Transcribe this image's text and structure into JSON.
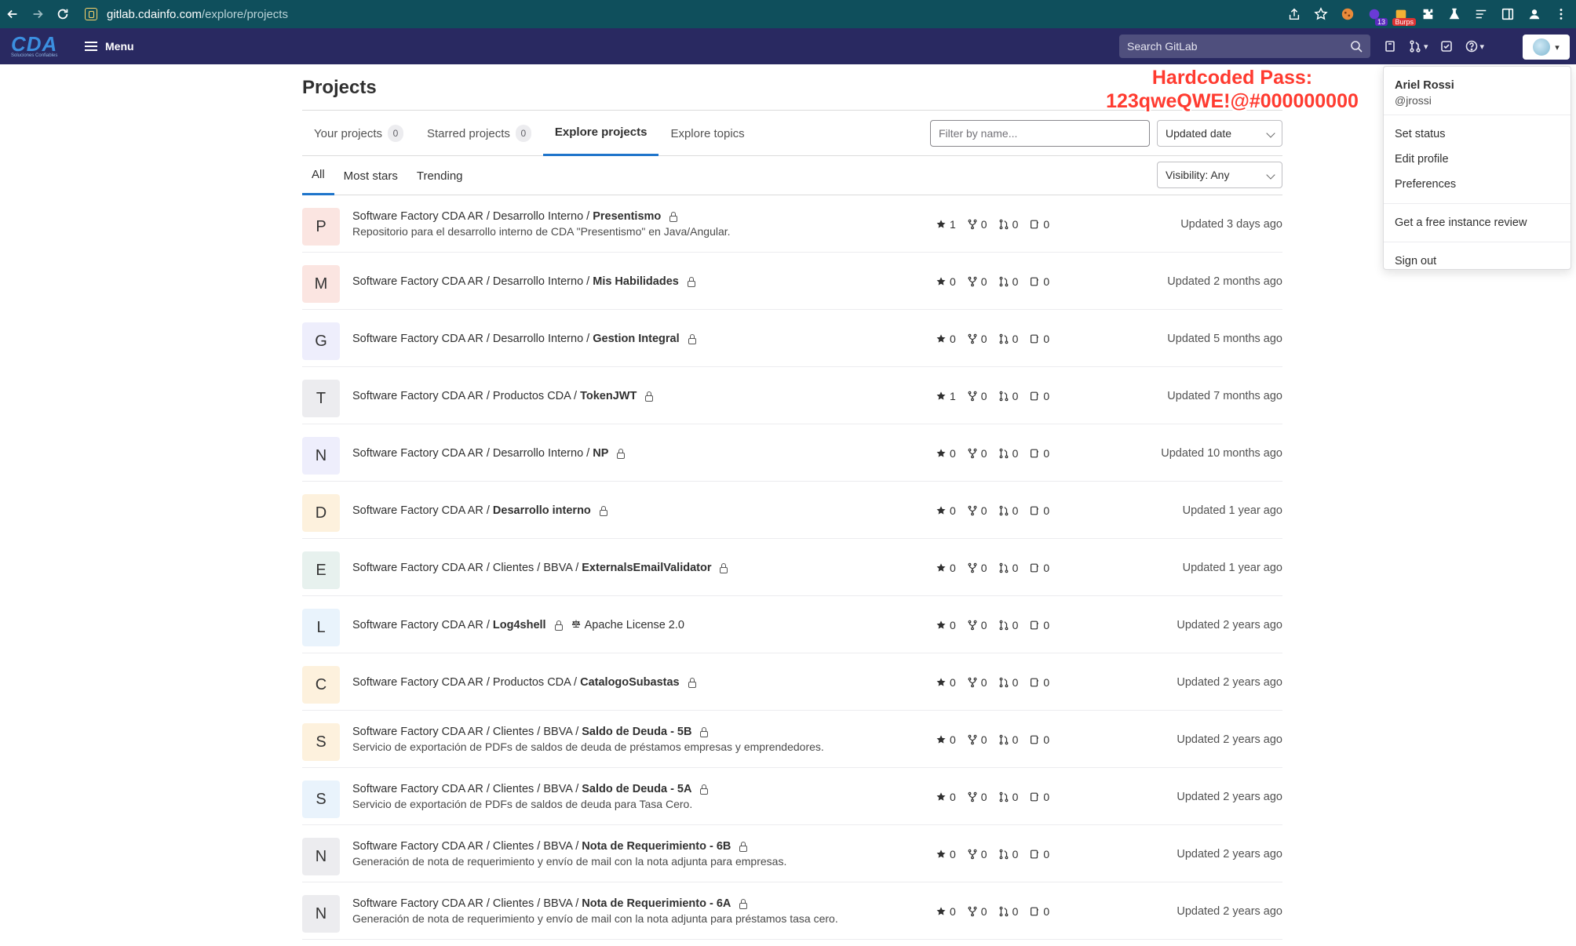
{
  "browser": {
    "url_domain": "gitlab.cdainfo.com",
    "url_path": "/explore/projects",
    "ext_badge_count": "13",
    "ext_badge_burp": "Burps"
  },
  "header": {
    "logo_text": "CDA",
    "logo_sub": "Soluciones Confiables",
    "menu_label": "Menu",
    "search_placeholder": "Search GitLab"
  },
  "page": {
    "title": "Projects",
    "tabs": [
      {
        "label": "Your projects",
        "count": "0"
      },
      {
        "label": "Starred projects",
        "count": "0"
      },
      {
        "label": "Explore projects"
      },
      {
        "label": "Explore topics"
      }
    ],
    "filter_placeholder": "Filter by name...",
    "sort_label": "Updated date",
    "subtabs": [
      "All",
      "Most stars",
      "Trending"
    ],
    "visibility_label": "Visibility: Any"
  },
  "annotation": {
    "line1": "Hardcoded Pass:",
    "line2": "123qweQWE!@#000000000"
  },
  "user_menu": {
    "name": "Ariel Rossi",
    "handle": "@jrossi",
    "items": [
      "Set status",
      "Edit profile",
      "Preferences"
    ],
    "review": "Get a free instance review",
    "signout": "Sign out"
  },
  "projects": [
    {
      "letter": "P",
      "bg": "#fbe5e1",
      "path": "Software Factory CDA AR / Desarrollo Interno / ",
      "name": "Presentismo",
      "desc": "Repositorio para el desarrollo interno de CDA \"Presentismo\" en Java/Angular.",
      "stars": "1",
      "forks": "0",
      "mrs": "0",
      "issues": "0",
      "updated": "Updated 3 days ago"
    },
    {
      "letter": "M",
      "bg": "#fbe5e1",
      "path": "Software Factory CDA AR / Desarrollo Interno / ",
      "name": "Mis Habilidades",
      "desc": "",
      "stars": "0",
      "forks": "0",
      "mrs": "0",
      "issues": "0",
      "updated": "Updated 2 months ago"
    },
    {
      "letter": "G",
      "bg": "#eeeefc",
      "path": "Software Factory CDA AR / Desarrollo Interno / ",
      "name": "Gestion Integral",
      "desc": "",
      "stars": "0",
      "forks": "0",
      "mrs": "0",
      "issues": "0",
      "updated": "Updated 5 months ago"
    },
    {
      "letter": "T",
      "bg": "#ececef",
      "path": "Software Factory CDA AR / Productos CDA / ",
      "name": "TokenJWT",
      "desc": "",
      "stars": "1",
      "forks": "0",
      "mrs": "0",
      "issues": "0",
      "updated": "Updated 7 months ago"
    },
    {
      "letter": "N",
      "bg": "#eeeefc",
      "path": "Software Factory CDA AR / Desarrollo Interno / ",
      "name": "NP",
      "desc": "",
      "stars": "0",
      "forks": "0",
      "mrs": "0",
      "issues": "0",
      "updated": "Updated 10 months ago"
    },
    {
      "letter": "D",
      "bg": "#fdf1dd",
      "path": "Software Factory CDA AR / ",
      "name": "Desarrollo interno",
      "desc": "",
      "stars": "0",
      "forks": "0",
      "mrs": "0",
      "issues": "0",
      "updated": "Updated 1 year ago"
    },
    {
      "letter": "E",
      "bg": "#e7f1ee",
      "path": "Software Factory CDA AR / Clientes / BBVA / ",
      "name": "ExternalsEmailValidator",
      "desc": "",
      "stars": "0",
      "forks": "0",
      "mrs": "0",
      "issues": "0",
      "updated": "Updated 1 year ago"
    },
    {
      "letter": "L",
      "bg": "#e9f3fc",
      "path": "Software Factory CDA AR / ",
      "name": "Log4shell",
      "license": "Apache License 2.0",
      "desc": "",
      "stars": "0",
      "forks": "0",
      "mrs": "0",
      "issues": "0",
      "updated": "Updated 2 years ago"
    },
    {
      "letter": "C",
      "bg": "#fdf1dd",
      "path": "Software Factory CDA AR / Productos CDA / ",
      "name": "CatalogoSubastas",
      "desc": "",
      "stars": "0",
      "forks": "0",
      "mrs": "0",
      "issues": "0",
      "updated": "Updated 2 years ago"
    },
    {
      "letter": "S",
      "bg": "#fdf1dd",
      "path": "Software Factory CDA AR / Clientes / BBVA / ",
      "name": "Saldo de Deuda - 5B",
      "desc": "Servicio de exportación de PDFs de saldos de deuda de préstamos empresas y emprendedores.",
      "stars": "0",
      "forks": "0",
      "mrs": "0",
      "issues": "0",
      "updated": "Updated 2 years ago"
    },
    {
      "letter": "S",
      "bg": "#e9f3fc",
      "path": "Software Factory CDA AR / Clientes / BBVA / ",
      "name": "Saldo de Deuda - 5A",
      "desc": "Servicio de exportación de PDFs de saldos de deuda para Tasa Cero.",
      "stars": "0",
      "forks": "0",
      "mrs": "0",
      "issues": "0",
      "updated": "Updated 2 years ago"
    },
    {
      "letter": "N",
      "bg": "#ececef",
      "path": "Software Factory CDA AR / Clientes / BBVA / ",
      "name": "Nota de Requerimiento - 6B",
      "desc": "Generación de nota de requerimiento y envío de mail con la nota adjunta para empresas.",
      "stars": "0",
      "forks": "0",
      "mrs": "0",
      "issues": "0",
      "updated": "Updated 2 years ago"
    },
    {
      "letter": "N",
      "bg": "#ececef",
      "path": "Software Factory CDA AR / Clientes / BBVA / ",
      "name": "Nota de Requerimiento - 6A",
      "desc": "Generación de nota de requerimiento y envío de mail con la nota adjunta para préstamos tasa cero.",
      "stars": "0",
      "forks": "0",
      "mrs": "0",
      "issues": "0",
      "updated": "Updated 2 years ago"
    }
  ]
}
